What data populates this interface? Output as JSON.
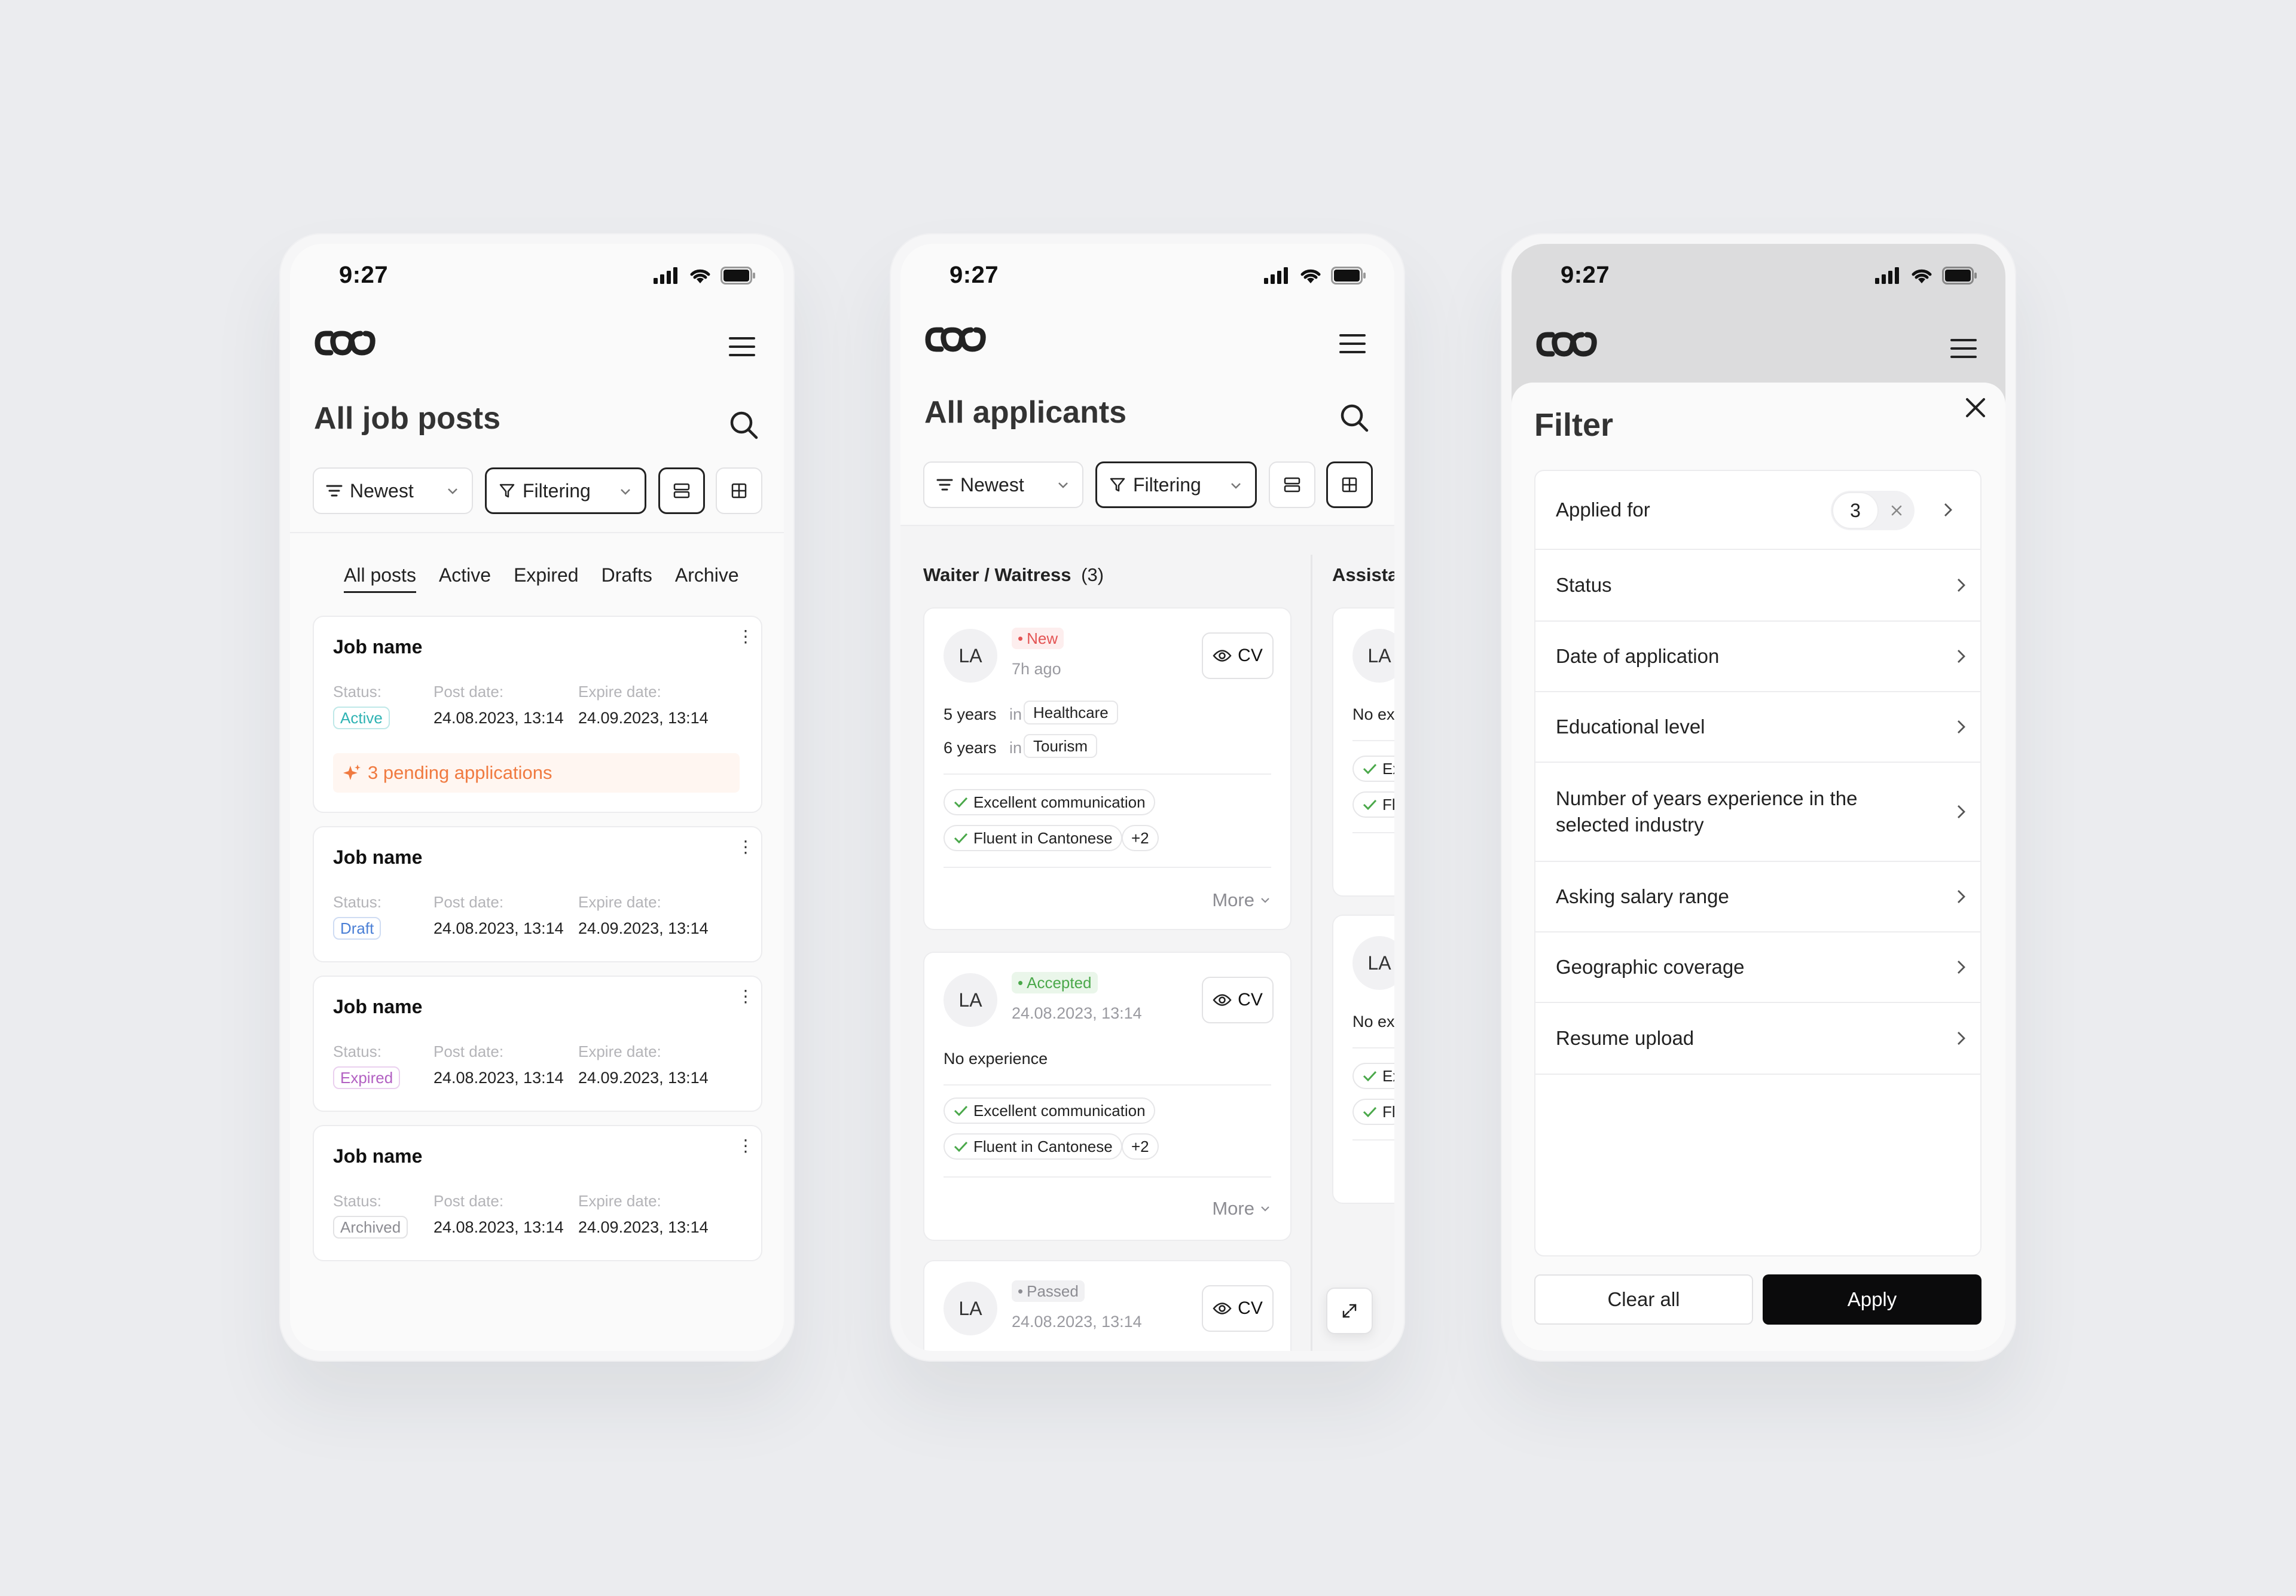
{
  "status_bar": {
    "time": "9:27"
  },
  "job_posts_screen": {
    "title": "All job posts",
    "sort_label": "Newest",
    "filter_label": "Filtering",
    "tabs": [
      {
        "label": "All posts",
        "active": true
      },
      {
        "label": "Active",
        "active": false
      },
      {
        "label": "Expired",
        "active": false
      },
      {
        "label": "Drafts",
        "active": false
      },
      {
        "label": "Archive",
        "active": false
      }
    ],
    "meta_labels": {
      "status": "Status:",
      "post_date": "Post date:",
      "expire_date": "Expire date:"
    },
    "cards": [
      {
        "name": "Job name",
        "status": "Active",
        "status_color": "#2fb3b3",
        "post_date": "24.08.2023, 13:14",
        "expire_date": "24.09.2023, 13:14",
        "pending": "3 pending applications"
      },
      {
        "name": "Job name",
        "status": "Draft",
        "status_color": "#4a7fd6",
        "post_date": "24.08.2023, 13:14",
        "expire_date": "24.09.2023, 13:14"
      },
      {
        "name": "Job name",
        "status": "Expired",
        "status_color": "#b260c2",
        "post_date": "24.08.2023, 13:14",
        "expire_date": "24.09.2023, 13:14"
      },
      {
        "name": "Job name",
        "status": "Archived",
        "status_color": "#8c8c92",
        "post_date": "24.08.2023, 13:14",
        "expire_date": "24.09.2023, 13:14"
      }
    ]
  },
  "applicants_screen": {
    "title": "All applicants",
    "sort_label": "Newest",
    "filter_label": "Filtering",
    "column_title": "Waiter / Waitress",
    "column_count": "(3)",
    "second_column_title": "Assista",
    "cv_label": "CV",
    "more_label": "More",
    "in_label": "in",
    "applicants": [
      {
        "initials": "LA",
        "status": "New",
        "status_color": "#e45454",
        "time": "7h ago",
        "experience": [
          {
            "years": "5 years",
            "industry": "Healthcare"
          },
          {
            "years": "6 years",
            "industry": "Tourism"
          }
        ],
        "skills": [
          "Excellent communication",
          "Fluent in Cantonese"
        ],
        "extra": "+2"
      },
      {
        "initials": "LA",
        "status": "Accepted",
        "status_color": "#4aa84a",
        "time": "24.08.2023, 13:14",
        "no_experience": "No experience",
        "skills": [
          "Excellent communication",
          "Fluent in Cantonese"
        ],
        "extra": "+2"
      },
      {
        "initials": "LA",
        "status": "Passed",
        "status_color": "#8c8c92",
        "time": "24.08.2023, 13:14"
      }
    ],
    "second_column_cards": [
      {
        "initials": "LA",
        "text": "No ex",
        "skills": [
          "Ex",
          "Fl"
        ]
      },
      {
        "initials": "LA",
        "text": "No ex",
        "skills": [
          "Ex",
          "Fl"
        ]
      }
    ]
  },
  "filter_screen": {
    "title": "Filter",
    "rows": [
      {
        "label": "Applied for",
        "count": "3"
      },
      {
        "label": "Status"
      },
      {
        "label": "Date of application"
      },
      {
        "label": "Educational level"
      },
      {
        "label": "Number of years experience in the selected industry"
      },
      {
        "label": "Asking salary range"
      },
      {
        "label": "Geographic coverage"
      },
      {
        "label": "Resume upload"
      }
    ],
    "clear_label": "Clear all",
    "apply_label": "Apply"
  }
}
